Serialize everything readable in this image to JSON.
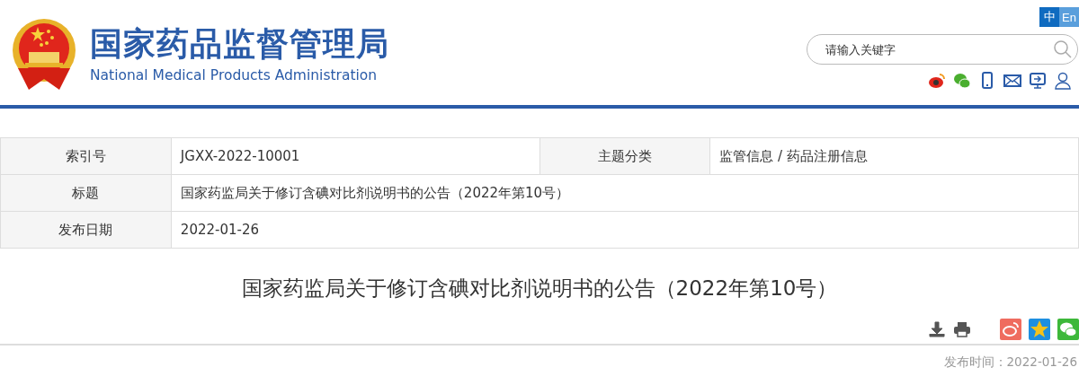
{
  "header": {
    "title": "国家药品监督管理局",
    "subtitle": "National Medical Products Administration"
  },
  "languages": [
    {
      "label": "中",
      "selected": true
    },
    {
      "label": "En",
      "selected": false
    }
  ],
  "search": {
    "placeholder": "请输入关键字"
  },
  "info_table": {
    "rows": [
      {
        "cells": [
          {
            "kind": "label",
            "text": "索引号"
          },
          {
            "kind": "value",
            "text": "JGXX-2022-10001"
          },
          {
            "kind": "label",
            "text": "主题分类"
          },
          {
            "kind": "value",
            "text": "监管信息 / 药品注册信息"
          }
        ]
      },
      {
        "cells": [
          {
            "kind": "label",
            "text": "标题"
          },
          {
            "kind": "value",
            "text": "国家药监局关于修订含碘对比剂说明书的公告（2022年第10号）",
            "colspan": 3
          }
        ]
      },
      {
        "cells": [
          {
            "kind": "label",
            "text": "发布日期"
          },
          {
            "kind": "value",
            "text": "2022-01-26",
            "colspan": 3
          }
        ]
      }
    ]
  },
  "article": {
    "title": "国家药监局关于修订含碘对比剂说明书的公告（2022年第10号）",
    "publish_time": "发布时间：2022-01-26"
  }
}
